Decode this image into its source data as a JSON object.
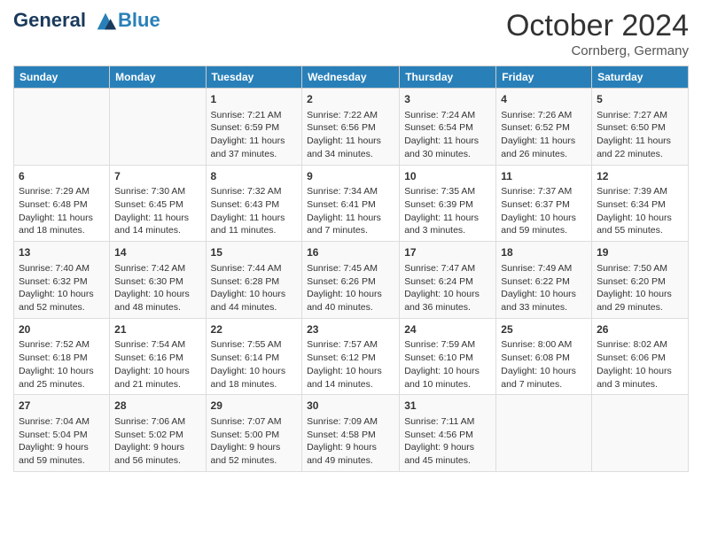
{
  "header": {
    "logo_line1": "General",
    "logo_line2": "Blue",
    "month": "October 2024",
    "location": "Cornberg, Germany"
  },
  "weekdays": [
    "Sunday",
    "Monday",
    "Tuesday",
    "Wednesday",
    "Thursday",
    "Friday",
    "Saturday"
  ],
  "weeks": [
    [
      {
        "day": "",
        "info": ""
      },
      {
        "day": "",
        "info": ""
      },
      {
        "day": "1",
        "info": "Sunrise: 7:21 AM\nSunset: 6:59 PM\nDaylight: 11 hours and 37 minutes."
      },
      {
        "day": "2",
        "info": "Sunrise: 7:22 AM\nSunset: 6:56 PM\nDaylight: 11 hours and 34 minutes."
      },
      {
        "day": "3",
        "info": "Sunrise: 7:24 AM\nSunset: 6:54 PM\nDaylight: 11 hours and 30 minutes."
      },
      {
        "day": "4",
        "info": "Sunrise: 7:26 AM\nSunset: 6:52 PM\nDaylight: 11 hours and 26 minutes."
      },
      {
        "day": "5",
        "info": "Sunrise: 7:27 AM\nSunset: 6:50 PM\nDaylight: 11 hours and 22 minutes."
      }
    ],
    [
      {
        "day": "6",
        "info": "Sunrise: 7:29 AM\nSunset: 6:48 PM\nDaylight: 11 hours and 18 minutes."
      },
      {
        "day": "7",
        "info": "Sunrise: 7:30 AM\nSunset: 6:45 PM\nDaylight: 11 hours and 14 minutes."
      },
      {
        "day": "8",
        "info": "Sunrise: 7:32 AM\nSunset: 6:43 PM\nDaylight: 11 hours and 11 minutes."
      },
      {
        "day": "9",
        "info": "Sunrise: 7:34 AM\nSunset: 6:41 PM\nDaylight: 11 hours and 7 minutes."
      },
      {
        "day": "10",
        "info": "Sunrise: 7:35 AM\nSunset: 6:39 PM\nDaylight: 11 hours and 3 minutes."
      },
      {
        "day": "11",
        "info": "Sunrise: 7:37 AM\nSunset: 6:37 PM\nDaylight: 10 hours and 59 minutes."
      },
      {
        "day": "12",
        "info": "Sunrise: 7:39 AM\nSunset: 6:34 PM\nDaylight: 10 hours and 55 minutes."
      }
    ],
    [
      {
        "day": "13",
        "info": "Sunrise: 7:40 AM\nSunset: 6:32 PM\nDaylight: 10 hours and 52 minutes."
      },
      {
        "day": "14",
        "info": "Sunrise: 7:42 AM\nSunset: 6:30 PM\nDaylight: 10 hours and 48 minutes."
      },
      {
        "day": "15",
        "info": "Sunrise: 7:44 AM\nSunset: 6:28 PM\nDaylight: 10 hours and 44 minutes."
      },
      {
        "day": "16",
        "info": "Sunrise: 7:45 AM\nSunset: 6:26 PM\nDaylight: 10 hours and 40 minutes."
      },
      {
        "day": "17",
        "info": "Sunrise: 7:47 AM\nSunset: 6:24 PM\nDaylight: 10 hours and 36 minutes."
      },
      {
        "day": "18",
        "info": "Sunrise: 7:49 AM\nSunset: 6:22 PM\nDaylight: 10 hours and 33 minutes."
      },
      {
        "day": "19",
        "info": "Sunrise: 7:50 AM\nSunset: 6:20 PM\nDaylight: 10 hours and 29 minutes."
      }
    ],
    [
      {
        "day": "20",
        "info": "Sunrise: 7:52 AM\nSunset: 6:18 PM\nDaylight: 10 hours and 25 minutes."
      },
      {
        "day": "21",
        "info": "Sunrise: 7:54 AM\nSunset: 6:16 PM\nDaylight: 10 hours and 21 minutes."
      },
      {
        "day": "22",
        "info": "Sunrise: 7:55 AM\nSunset: 6:14 PM\nDaylight: 10 hours and 18 minutes."
      },
      {
        "day": "23",
        "info": "Sunrise: 7:57 AM\nSunset: 6:12 PM\nDaylight: 10 hours and 14 minutes."
      },
      {
        "day": "24",
        "info": "Sunrise: 7:59 AM\nSunset: 6:10 PM\nDaylight: 10 hours and 10 minutes."
      },
      {
        "day": "25",
        "info": "Sunrise: 8:00 AM\nSunset: 6:08 PM\nDaylight: 10 hours and 7 minutes."
      },
      {
        "day": "26",
        "info": "Sunrise: 8:02 AM\nSunset: 6:06 PM\nDaylight: 10 hours and 3 minutes."
      }
    ],
    [
      {
        "day": "27",
        "info": "Sunrise: 7:04 AM\nSunset: 5:04 PM\nDaylight: 9 hours and 59 minutes."
      },
      {
        "day": "28",
        "info": "Sunrise: 7:06 AM\nSunset: 5:02 PM\nDaylight: 9 hours and 56 minutes."
      },
      {
        "day": "29",
        "info": "Sunrise: 7:07 AM\nSunset: 5:00 PM\nDaylight: 9 hours and 52 minutes."
      },
      {
        "day": "30",
        "info": "Sunrise: 7:09 AM\nSunset: 4:58 PM\nDaylight: 9 hours and 49 minutes."
      },
      {
        "day": "31",
        "info": "Sunrise: 7:11 AM\nSunset: 4:56 PM\nDaylight: 9 hours and 45 minutes."
      },
      {
        "day": "",
        "info": ""
      },
      {
        "day": "",
        "info": ""
      }
    ]
  ]
}
